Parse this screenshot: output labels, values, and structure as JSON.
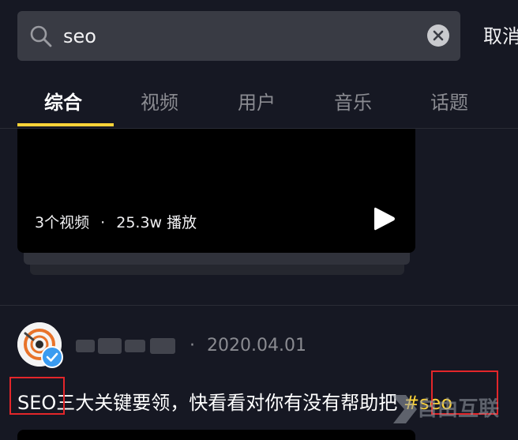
{
  "search": {
    "value": "seo",
    "cancel_label": "取消"
  },
  "tabs": [
    {
      "label": "综合",
      "active": true
    },
    {
      "label": "视频",
      "active": false
    },
    {
      "label": "用户",
      "active": false
    },
    {
      "label": "音乐",
      "active": false
    },
    {
      "label": "话题",
      "active": false
    }
  ],
  "collection_card": {
    "video_count": "3个视频",
    "separator": "·",
    "play_count": "25.3w 播放"
  },
  "post": {
    "username": "",
    "date_separator": "·",
    "date": "2020.04.01",
    "caption_prefix": "SEO",
    "caption_body": "三大关键要领，快看看对你有没有帮助把",
    "hashtag": "#seo"
  },
  "watermark": {
    "text": "自由互联"
  },
  "colors": {
    "background": "#161823",
    "search_background": "#393b44",
    "accent": "#fdd338",
    "highlight": "#e3262a",
    "verified": "#3a9bf0"
  }
}
